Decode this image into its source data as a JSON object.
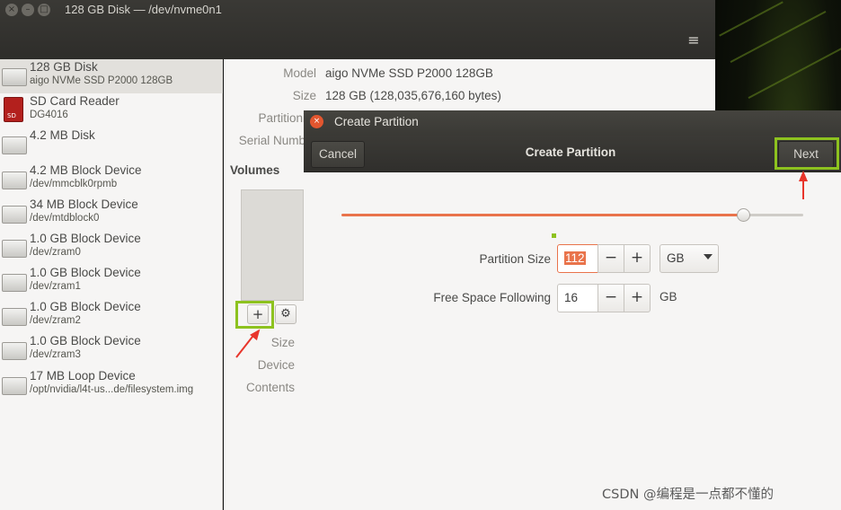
{
  "window": {
    "title": "128 GB Disk — /dev/nvme0n1",
    "close_glyph": "×",
    "min_glyph": "–",
    "max_glyph": "□",
    "menu_glyph": "≡"
  },
  "sidebar": {
    "devices": [
      {
        "name": "128 GB Disk",
        "sub": "aigo NVMe SSD P2000 128GB",
        "icon": "hard-disk-icon",
        "selected": true
      },
      {
        "name": "SD Card Reader",
        "sub": "DG4016",
        "icon": "sd-card-icon",
        "icon_text": "SD"
      },
      {
        "name": "4.2 MB Disk",
        "sub": "",
        "icon": "hard-disk-icon"
      },
      {
        "name": "4.2 MB Block Device",
        "sub": "/dev/mmcblk0rpmb",
        "icon": "block-device-icon"
      },
      {
        "name": "34 MB Block Device",
        "sub": "/dev/mtdblock0",
        "icon": "block-device-icon"
      },
      {
        "name": "1.0 GB Block Device",
        "sub": "/dev/zram0",
        "icon": "block-device-icon"
      },
      {
        "name": "1.0 GB Block Device",
        "sub": "/dev/zram1",
        "icon": "block-device-icon"
      },
      {
        "name": "1.0 GB Block Device",
        "sub": "/dev/zram2",
        "icon": "block-device-icon"
      },
      {
        "name": "1.0 GB Block Device",
        "sub": "/dev/zram3",
        "icon": "block-device-icon"
      },
      {
        "name": "17 MB Loop Device",
        "sub": "/opt/nvidia/l4t-us...de/filesystem.img",
        "icon": "loop-device-icon"
      }
    ]
  },
  "details": {
    "model_label": "Model",
    "model_value": "aigo NVMe SSD P2000 128GB",
    "size_label": "Size",
    "size_value": "128 GB (128,035,676,160 bytes)",
    "partitioning_label": "Partitioni",
    "serial_label": "Serial Numb",
    "volumes_heading": "Volumes",
    "vol_size_label": "Size",
    "vol_device_label": "Device",
    "vol_contents_label": "Contents",
    "add_glyph": "+",
    "settings_glyph": "⚙"
  },
  "dialog": {
    "title": "Create Partition",
    "close_glyph": "×",
    "cancel_label": "Cancel",
    "heading": "Create Partition",
    "next_label": "Next",
    "slider_fraction": 0.87,
    "partition_size_label": "Partition Size",
    "partition_size_value": "112",
    "partition_size_unit": "GB",
    "free_space_label": "Free Space Following",
    "free_space_value": "16",
    "free_space_unit": "GB",
    "minus_glyph": "−",
    "plus_glyph": "+"
  },
  "colors": {
    "accent": "#e9734b",
    "highlight": "#8dc21f",
    "arrow": "#e8352b"
  },
  "watermark": "CSDN @编程是一点都不懂的"
}
